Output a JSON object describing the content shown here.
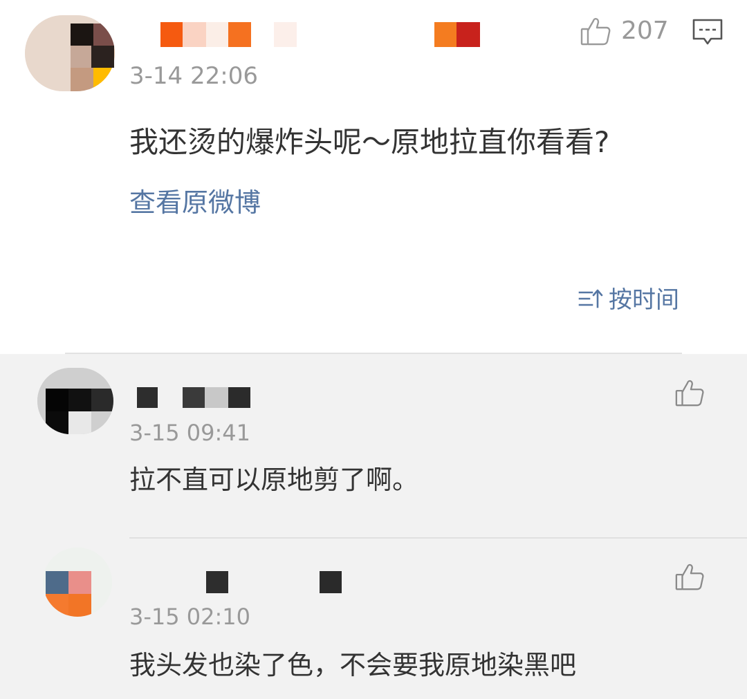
{
  "main_comment": {
    "timestamp": "3-14 22:06",
    "text": "我还烫的爆炸头呢～原地拉直你看看?",
    "like_count": "207",
    "view_original_label": "查看原微博"
  },
  "sort": {
    "label": "按时间"
  },
  "replies": [
    {
      "timestamp": "3-15 09:41",
      "text": "拉不直可以原地剪了啊。"
    },
    {
      "timestamp": "3-15 02:10",
      "text": "我头发也染了色，不会要我原地染黑吧"
    }
  ],
  "colors": {
    "link": "#5576a3",
    "timestamp": "#999999",
    "text": "#333333",
    "reply_background": "#f2f2f2"
  },
  "icons": {
    "like": "thumbs-up-icon",
    "reply": "comment-bubble-icon",
    "sort": "sort-arrows-icon"
  }
}
